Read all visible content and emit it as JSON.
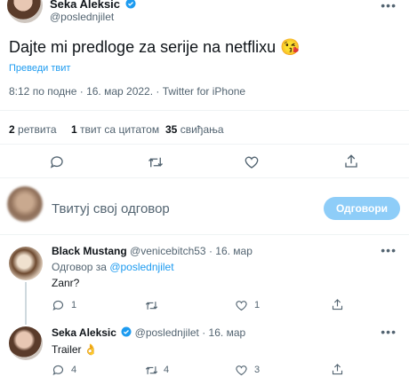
{
  "tweet": {
    "author_name": "Seka Aleksic",
    "author_handle": "@poslednjilet",
    "text": "Dajte mi predloge za serije na netflixu 😘",
    "translate_label": "Преведи твит",
    "timestamp": "8:12 по подне · 16. мар 2022. · Twitter for iPhone",
    "stats": {
      "retweets_count": "2",
      "retweets_label": "ретвита",
      "quotes_count": "1",
      "quotes_label": "твит са цитатом",
      "likes_count": "35",
      "likes_label": "свиђања"
    }
  },
  "compose": {
    "placeholder": "Твитуј свој одговор",
    "reply_button": "Одговори"
  },
  "replies": [
    {
      "author_name": "Black Mustang",
      "author_handle": "@venicebitch53",
      "date": "· 16. мар",
      "replying_prefix": "Одговор за",
      "replying_to": "@poslednjilet",
      "text": "Zanr?",
      "reply_count": "1",
      "retweet_count": "",
      "like_count": "1"
    },
    {
      "author_name": "Seka Aleksic",
      "author_handle": "@poslednjilet",
      "date": "· 16. мар",
      "text": "Trailer 👌",
      "reply_count": "4",
      "retweet_count": "4",
      "like_count": "3"
    }
  ],
  "colors": {
    "accent": "#1d9bf0",
    "muted": "#536471",
    "divider": "#eff3f4"
  }
}
